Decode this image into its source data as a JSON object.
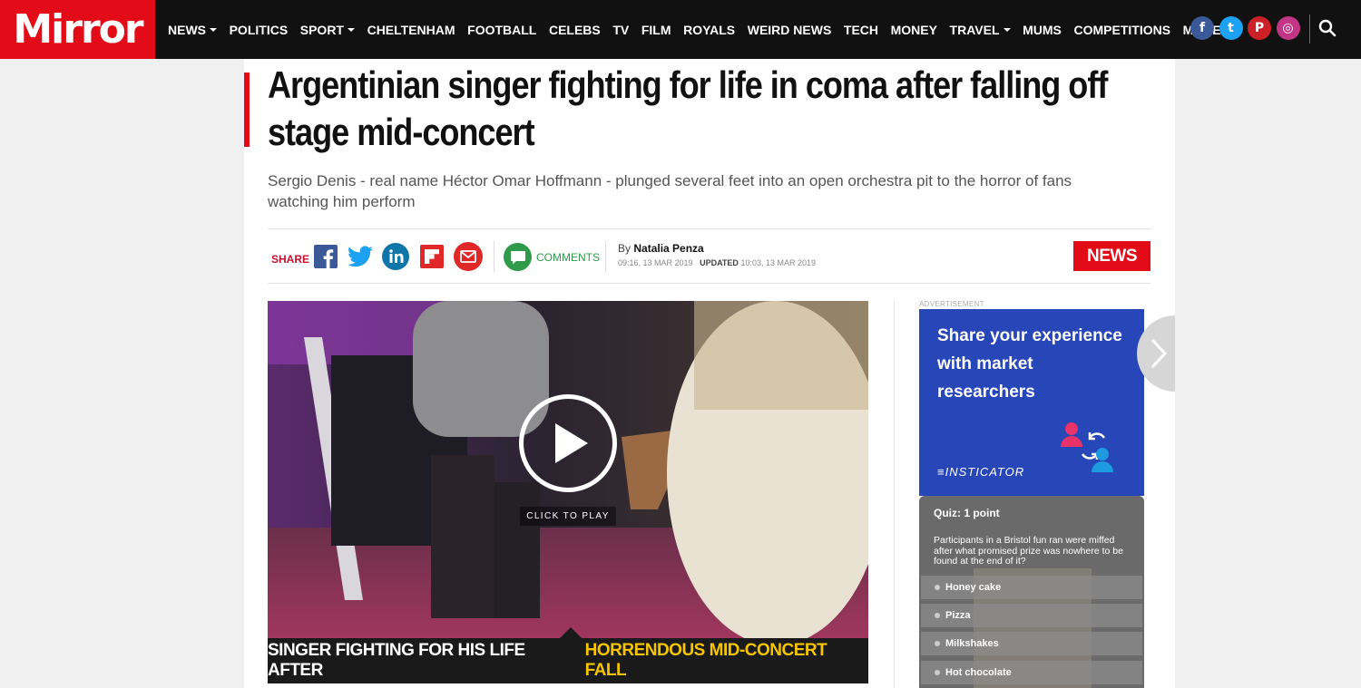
{
  "site": {
    "logo": "Mirror"
  },
  "nav": {
    "items": [
      {
        "label": "NEWS",
        "caret": true
      },
      {
        "label": "POLITICS",
        "caret": false
      },
      {
        "label": "SPORT",
        "caret": true
      },
      {
        "label": "CHELTENHAM",
        "caret": false
      },
      {
        "label": "FOOTBALL",
        "caret": false
      },
      {
        "label": "CELEBS",
        "caret": false
      },
      {
        "label": "TV",
        "caret": false
      },
      {
        "label": "FILM",
        "caret": false
      },
      {
        "label": "ROYALS",
        "caret": false
      },
      {
        "label": "WEIRD NEWS",
        "caret": false
      },
      {
        "label": "TECH",
        "caret": false
      },
      {
        "label": "MONEY",
        "caret": false
      },
      {
        "label": "TRAVEL",
        "caret": true
      },
      {
        "label": "MUMS",
        "caret": false
      },
      {
        "label": "COMPETITIONS",
        "caret": false
      },
      {
        "label": "MORE",
        "caret": true
      }
    ],
    "socials": [
      {
        "icon": "facebook-icon",
        "glyph": "f",
        "color": "#3b5998"
      },
      {
        "icon": "twitter-icon",
        "glyph": "t",
        "color": "#1da1f2"
      },
      {
        "icon": "pinterest-icon",
        "glyph": "P",
        "color": "#cb2027"
      },
      {
        "icon": "instagram-icon",
        "glyph": "◎",
        "color": "#c13584"
      }
    ]
  },
  "article": {
    "headline": "Argentinian singer fighting for life in coma after falling off stage mid-concert",
    "standfirst": "Sergio Denis - real name Héctor Omar Hoffmann - plunged several feet into an open orchestra pit to the horror of fans watching him perform",
    "share_label": "SHARE",
    "comments_label": "COMMENTS",
    "by_prefix": "By",
    "author": "Natalia Penza",
    "published": "09:16, 13 MAR 2019",
    "updated_label": "UPDATED",
    "updated": "10:03, 13 MAR 2019",
    "section_tag": "NEWS"
  },
  "video": {
    "click_to_play": "CLICK TO PLAY",
    "caption_white": "SINGER FIGHTING FOR HIS LIFE AFTER",
    "caption_yellow": "HORRENDOUS MID-CONCERT FALL"
  },
  "ad": {
    "label": "ADVERTISEMENT",
    "text": "Share your experience with market researchers",
    "brand": "≡INSTICATOR"
  },
  "quiz": {
    "title": "Quiz: 1 point",
    "question": "Participants in a Bristol fun ran were miffed after what promised prize was nowhere to be found at the end of it?",
    "options": [
      "Honey cake",
      "Pizza",
      "Milkshakes",
      "Hot chocolate"
    ]
  }
}
